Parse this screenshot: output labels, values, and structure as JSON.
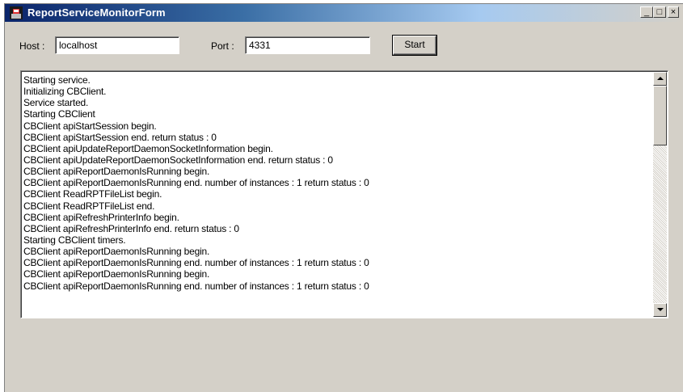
{
  "window": {
    "title": "ReportServiceMonitorForm",
    "controls": {
      "minimize": "_",
      "maximize": "□",
      "close": "×"
    },
    "icon": "app-icon"
  },
  "form": {
    "host_label": "Host :",
    "host_value": "localhost",
    "port_label": "Port :",
    "port_value": "4331",
    "start_button": "Start"
  },
  "log": {
    "lines": [
      "Starting service.",
      "Initializing CBClient.",
      "Service started.",
      "Starting CBClient",
      "CBClient apiStartSession begin.",
      "CBClient apiStartSession end. return status : 0",
      "CBClient apiUpdateReportDaemonSocketInformation begin.",
      "CBClient apiUpdateReportDaemonSocketInformation end. return status : 0",
      "CBClient apiReportDaemonIsRunning begin.",
      "CBClient apiReportDaemonIsRunning end. number of instances : 1 return status : 0",
      "CBClient ReadRPTFileList begin.",
      "CBClient ReadRPTFileList end.",
      "CBClient apiRefreshPrinterInfo begin.",
      "CBClient apiRefreshPrinterInfo end. return status : 0",
      "Starting CBClient timers.",
      "CBClient apiReportDaemonIsRunning begin.",
      "CBClient apiReportDaemonIsRunning end. number of instances : 1 return status : 0",
      "CBClient apiReportDaemonIsRunning begin.",
      "CBClient apiReportDaemonIsRunning end. number of instances : 1 return status : 0"
    ]
  },
  "colors": {
    "titlebar_start": "#0a246a",
    "window_face": "#d4d0c8"
  }
}
